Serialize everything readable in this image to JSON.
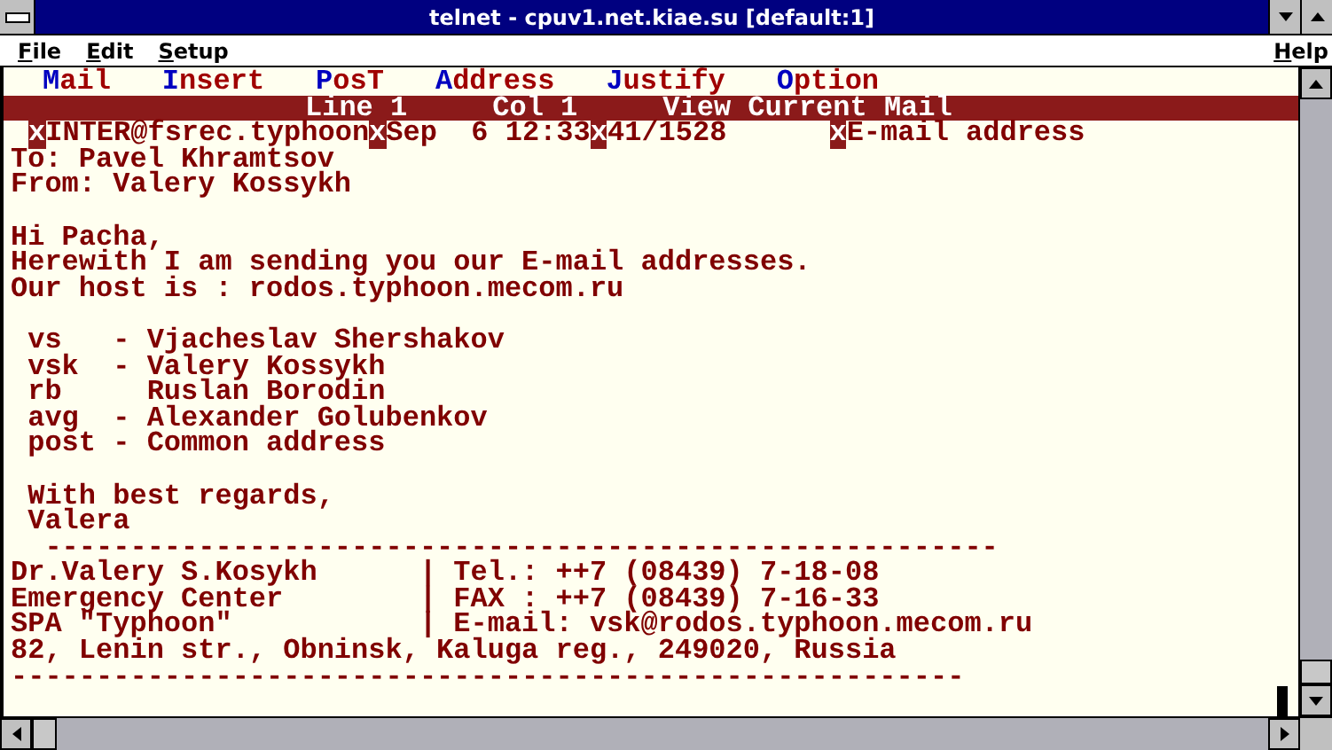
{
  "window": {
    "title": "telnet - cpuv1.net.kiae.su [default:1]"
  },
  "menu_bar": {
    "items": [
      {
        "label": "File"
      },
      {
        "label": "Edit"
      },
      {
        "label": "Setup"
      }
    ],
    "help": "Help"
  },
  "pine_menu": [
    {
      "label": "Mail"
    },
    {
      "label": "Insert"
    },
    {
      "label": "PosT"
    },
    {
      "label": "Address"
    },
    {
      "label": "Justify"
    },
    {
      "label": "Option"
    }
  ],
  "status_line": "Line 1     Col 1     View Current Mail",
  "header_fields": [
    {
      "marker": "x",
      "text": "INTER@fsrec.typhoon"
    },
    {
      "marker": "x",
      "text": "Sep  6 12:33"
    },
    {
      "marker": "x",
      "text": "41/1528"
    },
    {
      "marker": "x",
      "text": "E-mail address"
    }
  ],
  "message_blocks": [
    [
      "To: Pavel Khramtsov",
      "From: Valery Kossykh"
    ],
    [
      "Hi Pacha,",
      "Herewith I am sending you our E-mail addresses.",
      "Our host is : rodos.typhoon.mecom.ru"
    ],
    [
      " vs   - Vjacheslav Shershakov",
      " vsk  - Valery Kossykh",
      " rb     Ruslan Borodin",
      " avg  - Alexander Golubenkov",
      " post - Common address"
    ],
    [
      " With best regards,",
      " Valera",
      "  --------------------------------------------------------",
      "Dr.Valery S.Kosykh      | Tel.: ++7 (08439) 7-18-08",
      "Emergency Center        | FAX : ++7 (08439) 7-16-33",
      "SPA \"Typhoon\"           | E-mail: vsk@rodos.typhoon.mecom.ru",
      "82, Lenin str., Obninsk, Kaluga reg., 249020, Russia",
      "--------------------------------------------------------"
    ]
  ]
}
